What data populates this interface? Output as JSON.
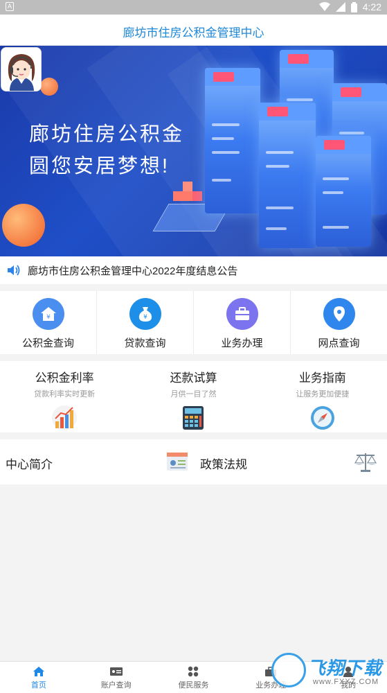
{
  "status_bar": {
    "time": "4:22",
    "notification_glyph": "A"
  },
  "header": {
    "title": "廊坊市住房公积金管理中心"
  },
  "banner": {
    "line1": "廊坊住房公积金",
    "line2": "圆您安居梦想!"
  },
  "notice": {
    "text": "廊坊市住房公积金管理中心2022年度结息公告"
  },
  "quick_grid": [
    {
      "label": "公积金查询",
      "icon": "house-yen-icon",
      "color": "#4a8ef0"
    },
    {
      "label": "贷款查询",
      "icon": "money-bag-icon",
      "color": "#1e8fe8"
    },
    {
      "label": "业务办理",
      "icon": "briefcase-icon",
      "color": "#7b74ee"
    },
    {
      "label": "网点查询",
      "icon": "location-pin-icon",
      "color": "#2f87ee"
    }
  ],
  "tools": [
    {
      "title": "公积金利率",
      "desc": "贷款利率实时更新",
      "icon": "rate-chart-icon"
    },
    {
      "title": "还款试算",
      "desc": "月供一目了然",
      "icon": "calculator-icon"
    },
    {
      "title": "业务指南",
      "desc": "让服务更加便捷",
      "icon": "compass-icon"
    }
  ],
  "intro": {
    "left": "中心简介",
    "right": "政策法规"
  },
  "tabbar": [
    {
      "label": "首页",
      "active": true
    },
    {
      "label": "账户查询",
      "active": false
    },
    {
      "label": "便民服务",
      "active": false
    },
    {
      "label": "业务办理",
      "active": false
    },
    {
      "label": "我的",
      "active": false
    }
  ],
  "watermark": {
    "brand": "飞翔下载",
    "url": "www.FXXZ.COM"
  }
}
